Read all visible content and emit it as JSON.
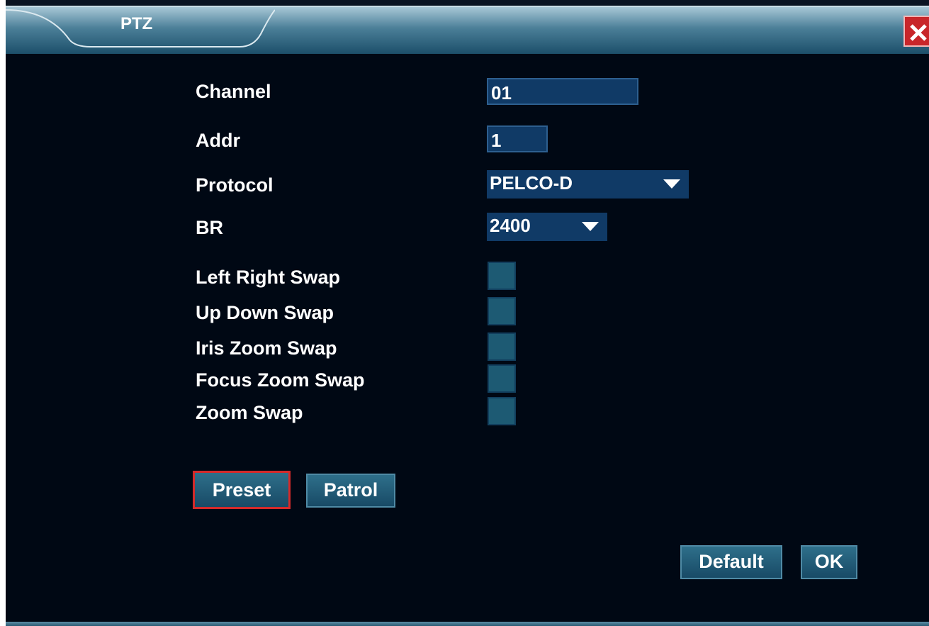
{
  "window": {
    "title": "PTZ"
  },
  "fields": {
    "channel": {
      "label": "Channel",
      "value": "01"
    },
    "addr": {
      "label": "Addr",
      "value": "1"
    },
    "protocol": {
      "label": "Protocol",
      "value": "PELCO-D"
    },
    "br": {
      "label": "BR",
      "value": "2400"
    }
  },
  "swaps": {
    "left_right": {
      "label": "Left Right Swap",
      "checked": false
    },
    "up_down": {
      "label": "Up Down Swap",
      "checked": false
    },
    "iris_zoom": {
      "label": "Iris Zoom Swap",
      "checked": false
    },
    "focus_zoom": {
      "label": "Focus Zoom Swap",
      "checked": false
    },
    "zoom": {
      "label": "Zoom Swap",
      "checked": false
    }
  },
  "buttons": {
    "preset": "Preset",
    "patrol": "Patrol",
    "default": "Default",
    "ok": "OK"
  },
  "colors": {
    "focus_border": "#d42a2a",
    "close_button": "#c8262a",
    "field_background": "#103a66"
  },
  "icons": {
    "close": "close-icon",
    "dropdown": "chevron-down-icon"
  }
}
